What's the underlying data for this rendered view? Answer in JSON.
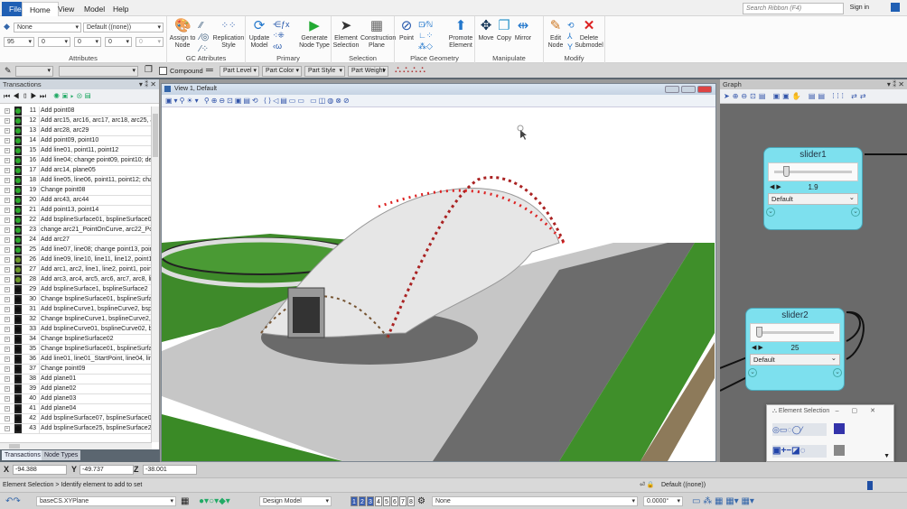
{
  "ribbon": {
    "tabs": [
      "File",
      "Home",
      "View",
      "Model",
      "Help"
    ],
    "search_placeholder": "Search Ribbon (F4)",
    "sign_in": "Sign in",
    "attributes": {
      "level": "None",
      "style": "Default ((none))",
      "color": "95",
      "weight1": "0",
      "weight2": "0",
      "weight3": "0",
      "weight4": "0",
      "label": "Attributes"
    },
    "groups": [
      {
        "label": "GC Attributes",
        "buttons": [
          "Assign to Node",
          "Replication Style"
        ]
      },
      {
        "label": "Primary",
        "buttons": [
          "Update Model",
          "Generate Node Type"
        ]
      },
      {
        "label": "Selection",
        "buttons": [
          "Element Selection",
          "Construction Plane"
        ]
      },
      {
        "label": "Place Geometry",
        "buttons": [
          "Point",
          "Promote Element"
        ]
      },
      {
        "label": "Manipulate",
        "buttons": [
          "Move",
          "Copy",
          "Mirror"
        ]
      },
      {
        "label": "Modify",
        "buttons": [
          "Edit Node",
          "Delete Submodel"
        ]
      }
    ]
  },
  "attrbar": {
    "compound": "Compound",
    "part_level": "Part Level",
    "part_color": "Part Color",
    "part_style": "Part Style",
    "part_weight": "Part Weight"
  },
  "transactions": {
    "title": "Transactions",
    "rows": [
      {
        "n": "11",
        "t": "Add point08",
        "s": "green"
      },
      {
        "n": "12",
        "t": "Add arc15, arc16, arc17, arc18, arc25, arc26;",
        "s": "green"
      },
      {
        "n": "13",
        "t": "Add arc28, arc29",
        "s": "green"
      },
      {
        "n": "14",
        "t": "Add point09, point10",
        "s": "green"
      },
      {
        "n": "15",
        "t": "Add line01, point11, point12",
        "s": "green"
      },
      {
        "n": "16",
        "t": "Add line04; change point09, point10; delete",
        "s": "green"
      },
      {
        "n": "17",
        "t": "Add arc14, plane05",
        "s": "green"
      },
      {
        "n": "18",
        "t": "Add line05, line06, point11, point12; change",
        "s": "green"
      },
      {
        "n": "19",
        "t": "Change point08",
        "s": "green"
      },
      {
        "n": "20",
        "t": "Add arc43, arc44",
        "s": "green"
      },
      {
        "n": "21",
        "t": "Add point13, point14",
        "s": "green"
      },
      {
        "n": "22",
        "t": "Add bsplineSurface01, bsplineSurface02, bsp",
        "s": "green"
      },
      {
        "n": "23",
        "t": "change arc21_PointOnCurve, arc22_PointOn",
        "s": "green"
      },
      {
        "n": "24",
        "t": "Add arc27",
        "s": "green"
      },
      {
        "n": "25",
        "t": "Add line07, line08; change point13, point14",
        "s": "green"
      },
      {
        "n": "26",
        "t": "Add line09, line10, line11, line12, point15, po",
        "s": "olive"
      },
      {
        "n": "27",
        "t": "Add arc1, arc2, line1, line2, point1, point2; ch",
        "s": "olive"
      },
      {
        "n": "28",
        "t": "Add arc3, arc4, arc5, arc6, arc7, arc8, line3, li",
        "s": "olive"
      },
      {
        "n": "29",
        "t": "Add bsplineSurface1, bsplineSurface2",
        "s": "black"
      },
      {
        "n": "30",
        "t": "Change bsplineSurface01, bsplineSurface02,",
        "s": "black"
      },
      {
        "n": "31",
        "t": "Add bsplineCurve1, bsplineCurve2, bsplineC",
        "s": "black"
      },
      {
        "n": "32",
        "t": "Change bsplineCurve1, bsplineCurve2, bsplin",
        "s": "black"
      },
      {
        "n": "33",
        "t": "Add bsplineCurve01, bsplineCurve02, bsplin",
        "s": "black"
      },
      {
        "n": "34",
        "t": "Change bsplineSurface02",
        "s": "black"
      },
      {
        "n": "35",
        "t": "Change bsplineSurface01, bsplineSurface02,",
        "s": "black"
      },
      {
        "n": "36",
        "t": "Add line01, line01_StartPoint, line04, line04_",
        "s": "black"
      },
      {
        "n": "37",
        "t": "Change point09",
        "s": "black"
      },
      {
        "n": "38",
        "t": "Add plane01",
        "s": "black"
      },
      {
        "n": "39",
        "t": "Add plane02",
        "s": "black"
      },
      {
        "n": "40",
        "t": "Add plane03",
        "s": "black"
      },
      {
        "n": "41",
        "t": "Add plane04",
        "s": "black"
      },
      {
        "n": "42",
        "t": "Add bsplineSurface07, bsplineSurface08, bsp",
        "s": "black"
      },
      {
        "n": "43",
        "t": "Add bsplineSurface25, bsplineSurface26, bsp",
        "s": "black"
      }
    ],
    "tabs": [
      "Transactions",
      "Node Types"
    ]
  },
  "view": {
    "title": "View 1, Default"
  },
  "graph": {
    "title": "Graph",
    "nodes": [
      {
        "name": "slider1",
        "value": "1.9",
        "option": "Default",
        "level": 0.12
      },
      {
        "name": "slider2",
        "value": "25",
        "option": "Default",
        "level": 0.0
      }
    ],
    "element_selection": {
      "title": "Element Selection"
    }
  },
  "coords": {
    "x": "-94.388",
    "y": "-49.737",
    "z": "-38.001"
  },
  "status": {
    "prompt": "Element Selection > Identify element to add to set",
    "level": "Default ((none))"
  },
  "bottom": {
    "plane": "baseCS.XYPlane",
    "model": "Design Model",
    "views": [
      "1",
      "2",
      "3",
      "4",
      "5",
      "6",
      "7",
      "8"
    ],
    "level": "None",
    "angle": "0.0000°"
  },
  "colors": {
    "accent": "#1f5fb4",
    "node": "#7de0ee",
    "status_green": "#2ea82e",
    "status_olive": "#6f9a2a",
    "status_black": "#111111"
  }
}
